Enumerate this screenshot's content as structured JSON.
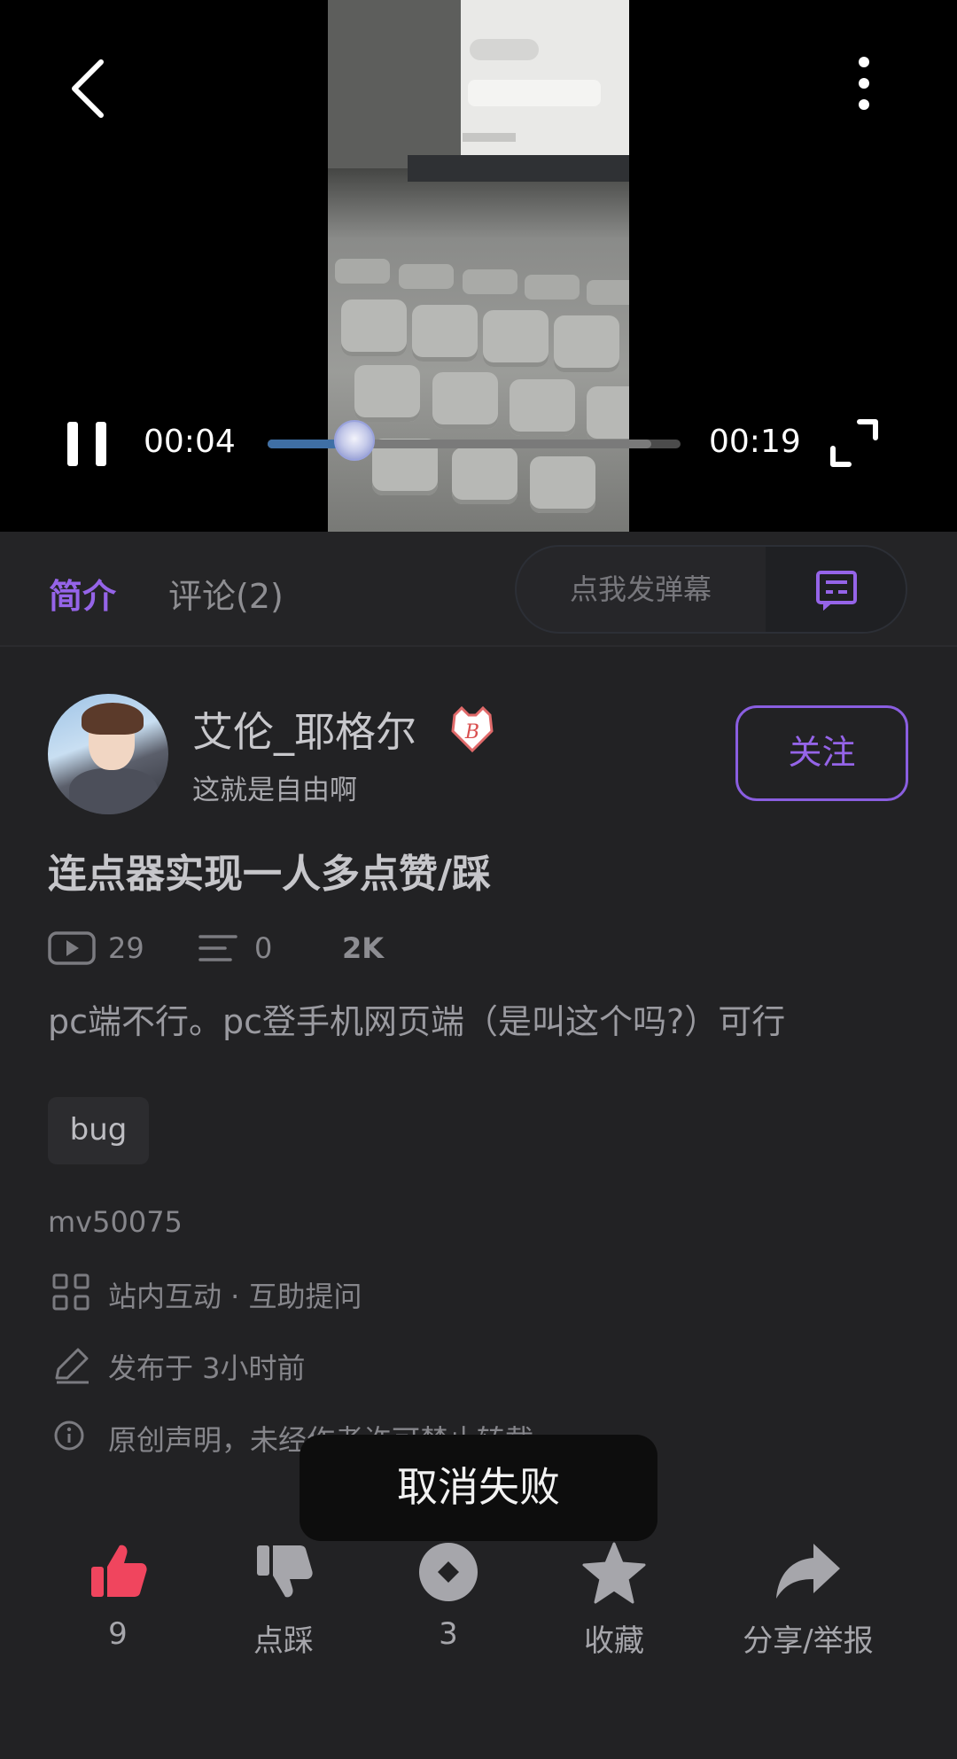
{
  "player": {
    "current_time": "00:04",
    "total_time": "00:19",
    "progress_fraction": 0.21,
    "buffer_fraction": 0.93
  },
  "tabs": {
    "intro": "简介",
    "comments": "评论(2)"
  },
  "danmaku": {
    "placeholder": "点我发弹幕"
  },
  "author": {
    "name": "艾伦_耶格尔",
    "signature": "这就是自由啊",
    "follow_label": "关注"
  },
  "post": {
    "title": "连点器实现一人多点赞/踩",
    "plays": "29",
    "danmaku_count": "0",
    "extra_stat": "2K",
    "description": "pc端不行。pc登手机网页端（是叫这个吗?）可行",
    "tag": "bug",
    "id": "mv50075",
    "category": "站内互动 · 互助提问",
    "published": "发布于 3小时前",
    "copyright": "原创声明，未经作者许可禁止转载"
  },
  "toast": "取消失败",
  "actions": {
    "like": "9",
    "dislike": "点踩",
    "coin": "3",
    "favorite": "收藏",
    "share": "分享/举报"
  },
  "colors": {
    "accent": "#9564e8",
    "like_red": "#f0455e",
    "background": "#222224"
  }
}
